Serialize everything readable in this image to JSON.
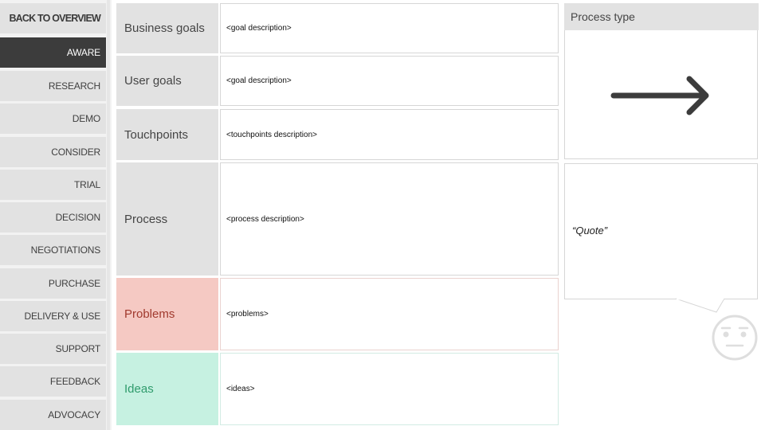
{
  "sidebar": {
    "back_label": "BACK TO OVERVIEW",
    "active_stage": "AWARE",
    "stages": [
      {
        "label": "AWARE",
        "active": true
      },
      {
        "label": "RESEARCH",
        "active": false
      },
      {
        "label": "DEMO",
        "active": false
      },
      {
        "label": "CONSIDER",
        "active": false
      },
      {
        "label": "TRIAL",
        "active": false
      },
      {
        "label": "DECISION",
        "active": false
      },
      {
        "label": "NEGOTIATIONS",
        "active": false
      },
      {
        "label": "PURCHASE",
        "active": false
      },
      {
        "label": "DELIVERY & USE",
        "active": false
      },
      {
        "label": "SUPPORT",
        "active": false
      },
      {
        "label": "FEEDBACK",
        "active": false
      },
      {
        "label": "ADVOCACY",
        "active": false
      }
    ]
  },
  "rows": [
    {
      "label": "Business goals",
      "value": "<goal description>"
    },
    {
      "label": "User goals",
      "value": "<goal description>"
    },
    {
      "label": "Touchpoints",
      "value": "<touchpoints description>"
    },
    {
      "label": "Process",
      "value": "<process description>"
    },
    {
      "label": "Problems",
      "value": "<problems>"
    },
    {
      "label": "Ideas",
      "value": "<ideas>"
    }
  ],
  "process_type": {
    "title": "Process type",
    "icon": "arrow-right-icon"
  },
  "quote": {
    "text": "“Quote”",
    "mood_icon": "neutral-face-icon"
  },
  "colors": {
    "active_stage_bg": "#3c3c3c",
    "problems_bg": "#f5c9c3",
    "problems_text": "#a13a2e",
    "ideas_bg": "#c6f1e1",
    "ideas_text": "#2f9b6c"
  }
}
